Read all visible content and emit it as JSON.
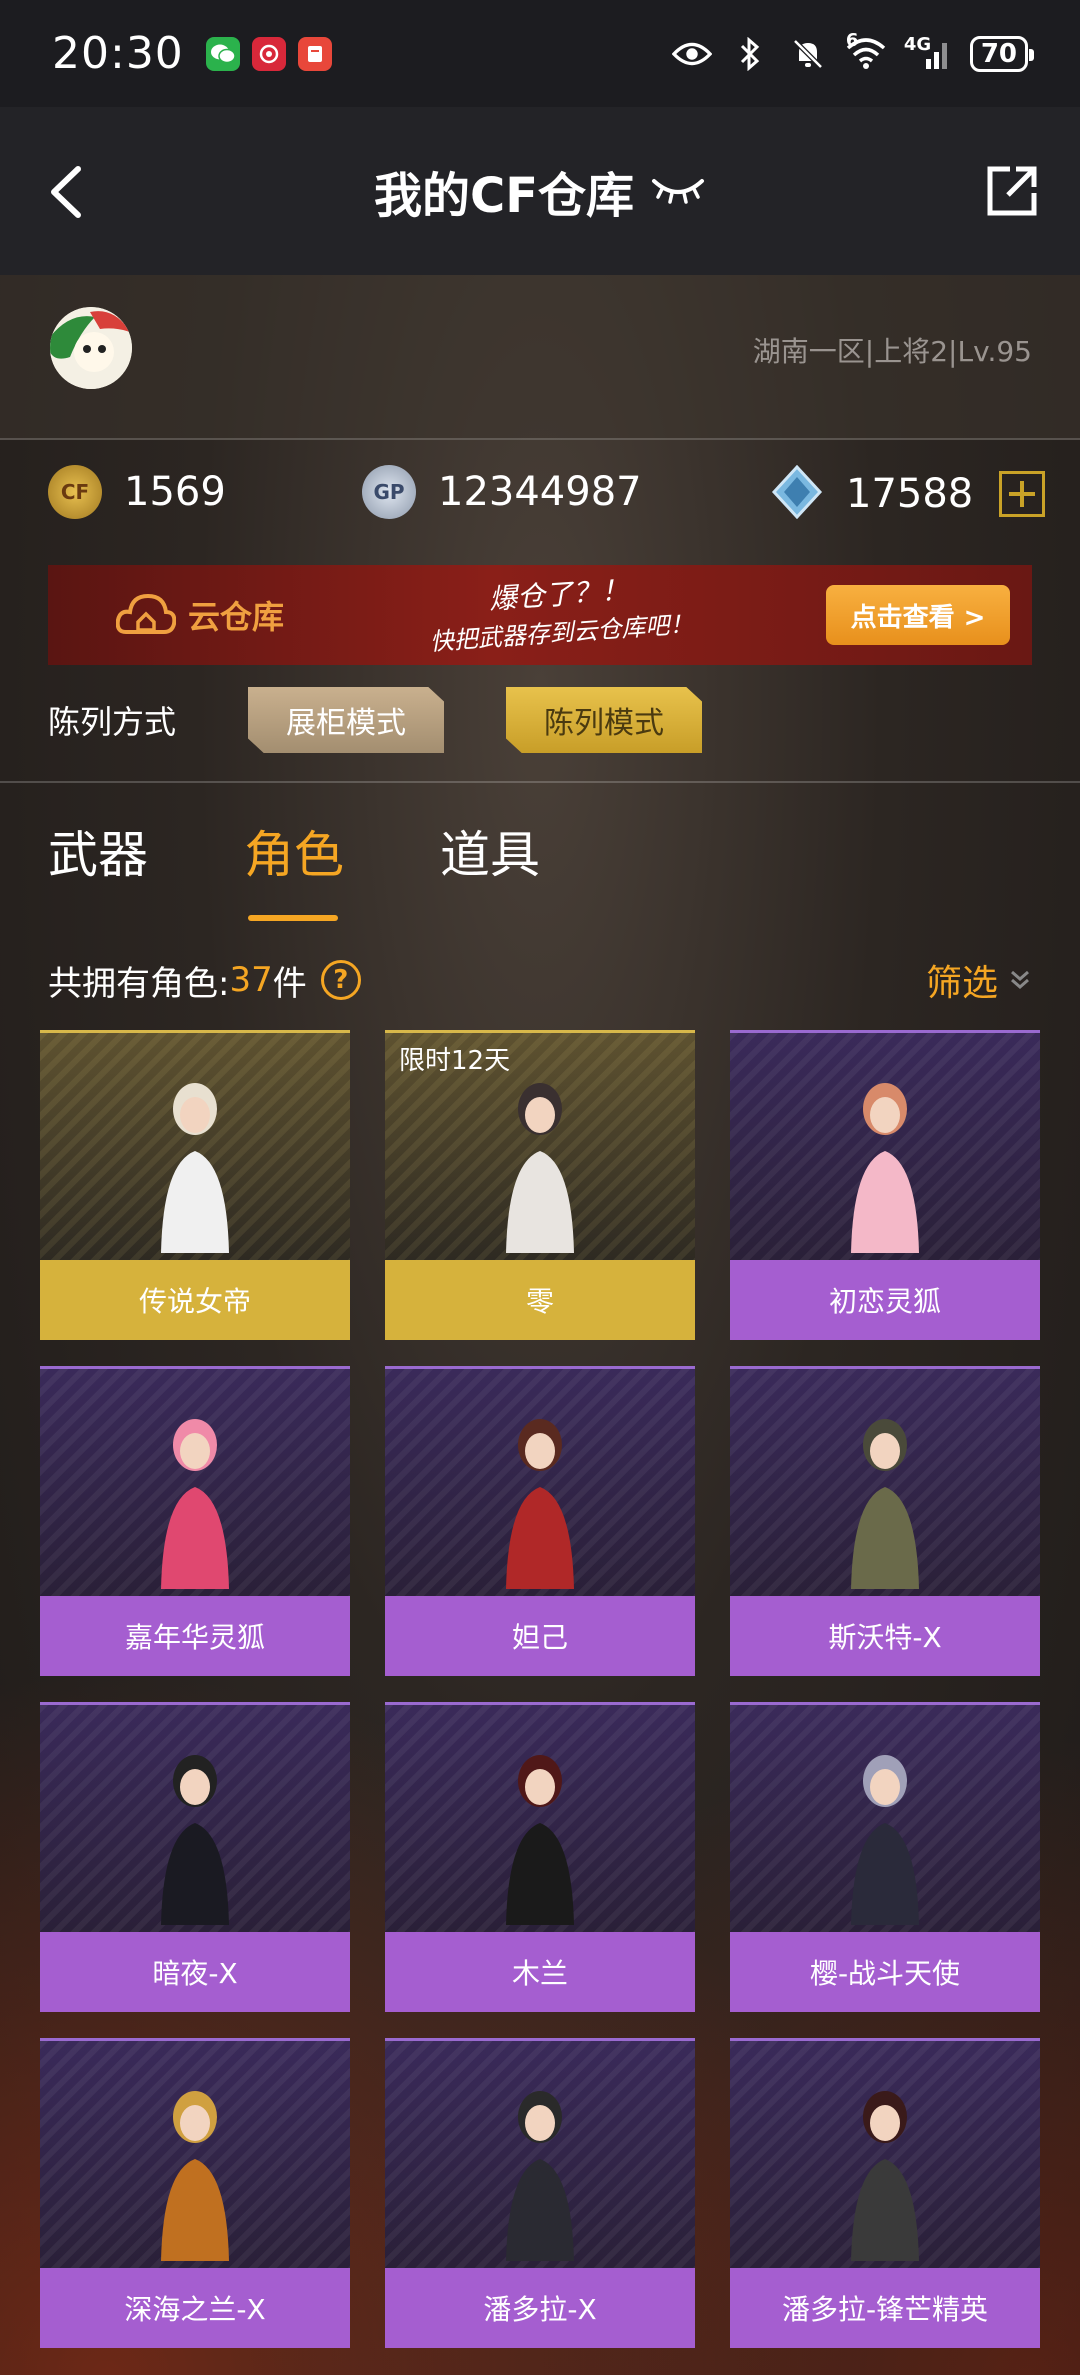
{
  "status_bar": {
    "time": "20:30",
    "battery": "70",
    "signal_label": "4G",
    "wifi_sup": "6"
  },
  "header": {
    "title": "我的CF仓库"
  },
  "profile": {
    "rank_text": "湖南一区|上将2|Lv.95"
  },
  "currencies": [
    {
      "icon": "cf-coin-icon",
      "value": "1569"
    },
    {
      "icon": "gp-coin-icon",
      "value": "12344987"
    },
    {
      "icon": "diamond-icon",
      "value": "17588"
    }
  ],
  "banner": {
    "logo_text": "云仓库",
    "slogan_line1": "爆仓了？！",
    "slogan_line2": "快把武器存到云仓库吧！",
    "button_label": "点击查看 >"
  },
  "display_mode": {
    "label": "陈列方式",
    "options": [
      "展柜模式",
      "陈列模式"
    ],
    "selected": "陈列模式"
  },
  "tabs": [
    {
      "label": "武器",
      "active": false
    },
    {
      "label": "角色",
      "active": true
    },
    {
      "label": "道具",
      "active": false
    }
  ],
  "count": {
    "label": "共拥有角色:",
    "number": "37",
    "unit": "件"
  },
  "filter": {
    "label": "筛选"
  },
  "colors": {
    "accent": "#f5a623",
    "gold_card": "#d6b23c",
    "purple_card": "#a55ed0"
  },
  "characters": [
    {
      "name": "传说女帝",
      "tier": "gold",
      "badge": ""
    },
    {
      "name": "零",
      "tier": "gold",
      "badge": "限时12天"
    },
    {
      "name": "初恋灵狐",
      "tier": "purple",
      "badge": ""
    },
    {
      "name": "嘉年华灵狐",
      "tier": "purple",
      "badge": ""
    },
    {
      "name": "妲己",
      "tier": "purple",
      "badge": ""
    },
    {
      "name": "斯沃特-X",
      "tier": "purple",
      "badge": ""
    },
    {
      "name": "暗夜-X",
      "tier": "purple",
      "badge": ""
    },
    {
      "name": "木兰",
      "tier": "purple",
      "badge": ""
    },
    {
      "name": "樱-战斗天使",
      "tier": "purple",
      "badge": ""
    },
    {
      "name": "深海之兰-X",
      "tier": "purple",
      "badge": ""
    },
    {
      "name": "潘多拉-X",
      "tier": "purple",
      "badge": ""
    },
    {
      "name": "潘多拉-锋芒精英",
      "tier": "purple",
      "badge": ""
    }
  ]
}
